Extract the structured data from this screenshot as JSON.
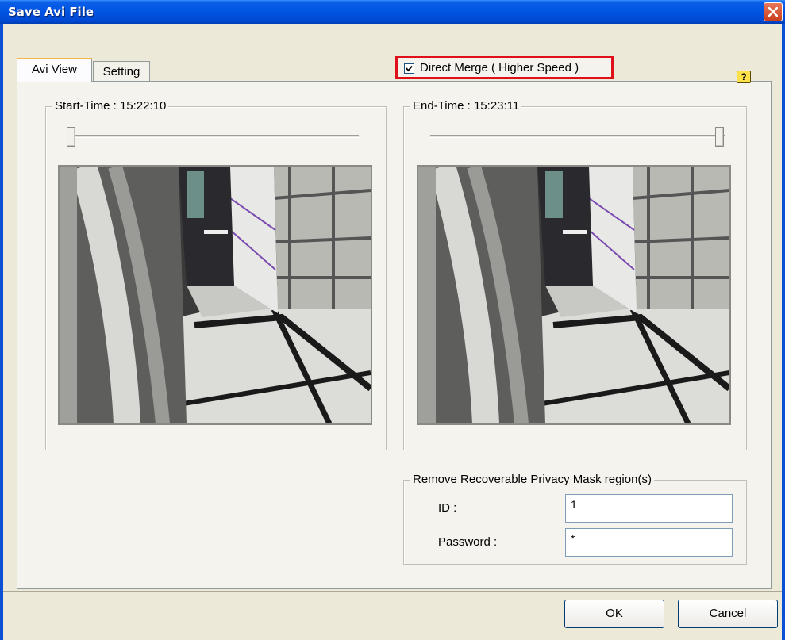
{
  "window": {
    "title": "Save Avi File"
  },
  "tabs": [
    {
      "label": "Avi View"
    },
    {
      "label": "Setting"
    }
  ],
  "direct_merge": {
    "label": "Direct Merge ( Higher Speed )",
    "checked": true
  },
  "start": {
    "label": "Start-Time : 15:22:10",
    "slider_fraction": 0.0
  },
  "end": {
    "label": "End-Time : 15:23:11",
    "slider_fraction": 1.0
  },
  "privacy_mask": {
    "legend": "Remove Recoverable Privacy Mask region(s)",
    "id_label": "ID :",
    "id_value": "1",
    "password_label": "Password :",
    "password_value": "*"
  },
  "buttons": {
    "ok": "OK",
    "cancel": "Cancel"
  },
  "icons": {
    "help": "help-icon",
    "close": "close-icon"
  },
  "colors": {
    "titlebar": "#0054e3",
    "highlight_border": "#e0101a",
    "dialog_bg": "#ece9d8"
  }
}
